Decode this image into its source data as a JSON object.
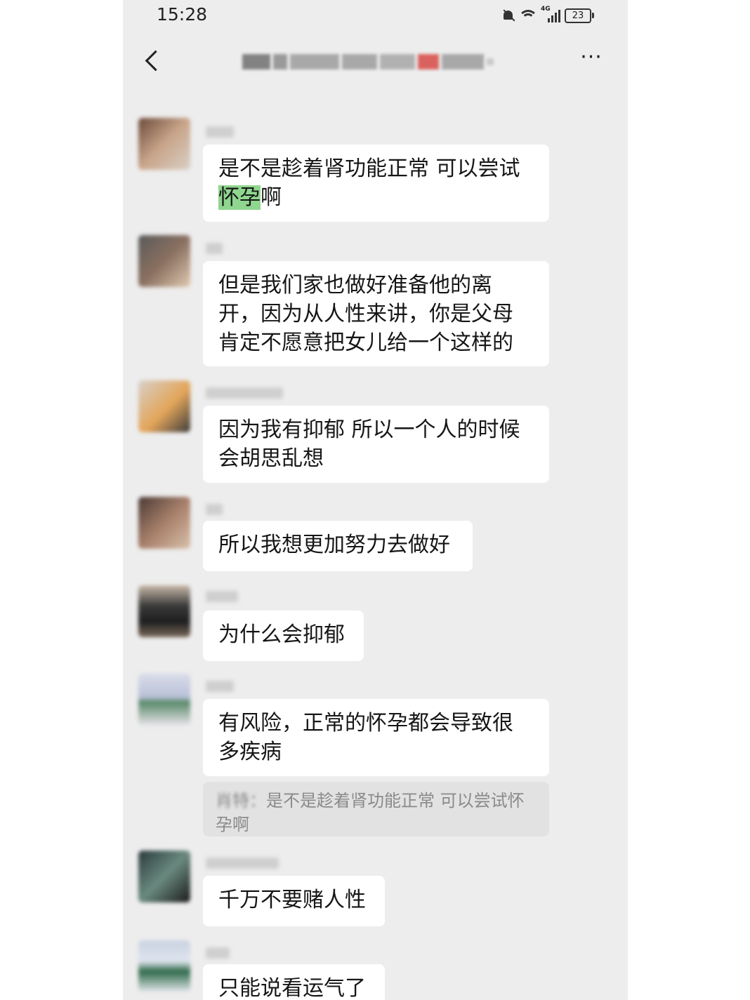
{
  "status_bar": {
    "time": "15:28",
    "battery": "23",
    "network": "4G"
  },
  "header": {
    "back_icon": "chevron-left-icon",
    "more_icon": "more-dots-icon",
    "more_label": "···"
  },
  "messages": [
    {
      "text_parts": [
        "是不是趁着肾功能正常 可以尝试",
        "怀孕",
        "啊"
      ],
      "highlight": "怀孕"
    },
    {
      "text": "但是我们家也做好准备他的离开，因为从人性来讲，你是父母肯定不愿意把女儿给一个这样的"
    },
    {
      "text": "因为我有抑郁 所以一个人的时候会胡思乱想"
    },
    {
      "text": "所以我想更加努力去做好"
    },
    {
      "text": "为什么会抑郁"
    },
    {
      "text": "有风险，正常的怀孕都会导致很多疾病",
      "quote_prefix": "肖特：",
      "quote_text": "是不是趁着肾功能正常 可以尝试怀孕啊"
    },
    {
      "text": "千万不要赌人性"
    },
    {
      "text": "只能说看运气了"
    }
  ],
  "colors": {
    "background": "#ededed",
    "bubble": "#ffffff",
    "highlight": "#8fd68f",
    "quote_bg": "#e2e2e2"
  }
}
